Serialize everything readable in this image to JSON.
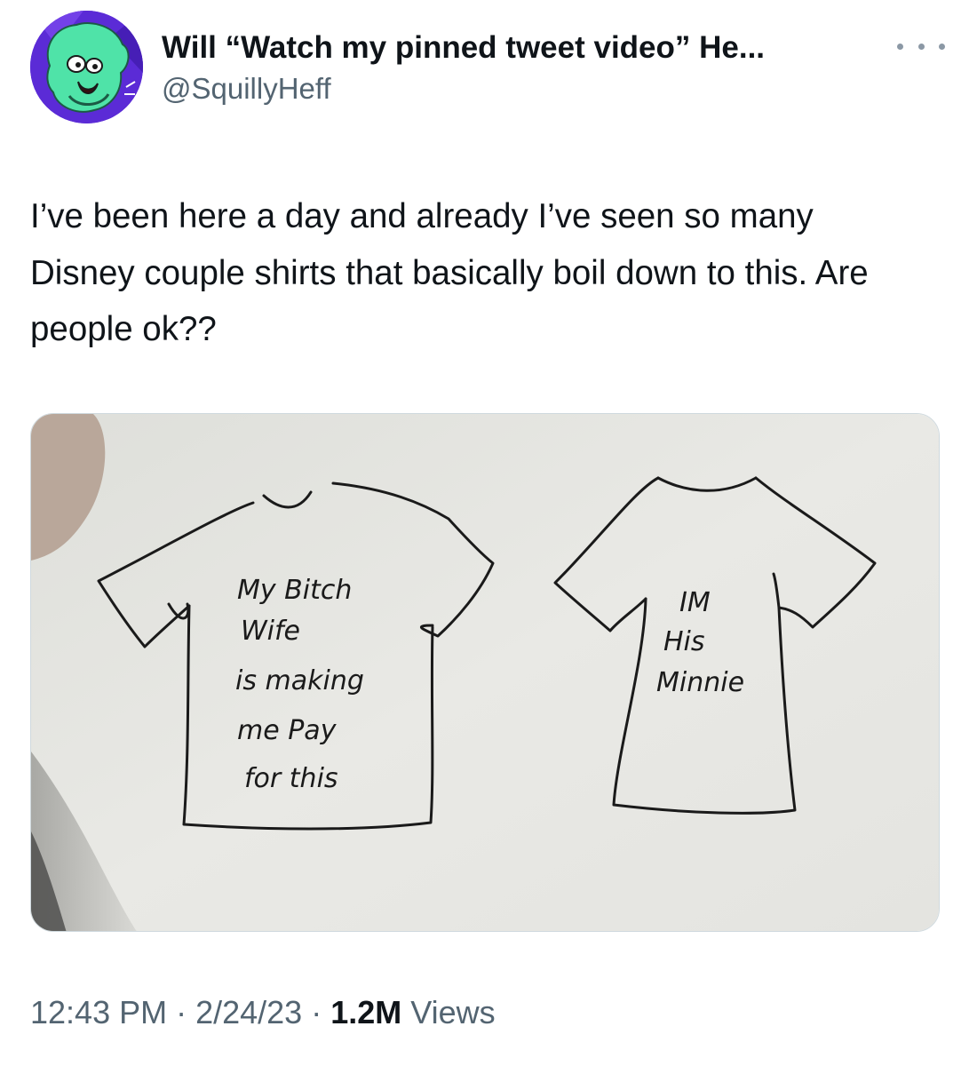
{
  "author": {
    "display_name": "Will “Watch my pinned tweet video” He...",
    "handle": "@SquillyHeff",
    "avatar_icon": "cartoon-avatar-icon"
  },
  "more_icon": "more-options-icon",
  "tweet": {
    "text": "I’ve been here a day and already I’ve seen so many Disney couple shirts that basically boil down to this. Are people ok??"
  },
  "media": {
    "left_shirt_lines": [
      "My Bitch",
      "Wife",
      "is making",
      "me Pay",
      "for this"
    ],
    "right_shirt_lines": [
      "IM",
      "His",
      "Minnie"
    ]
  },
  "meta": {
    "time": "12:43 PM",
    "separator": " · ",
    "date": "2/24/23",
    "views_count": "1.2M",
    "views_label": "Views"
  },
  "colors": {
    "text_primary": "#0f1419",
    "text_secondary": "#536471",
    "avatar_bg": "#5b2bd6",
    "avatar_face": "#4fe3a8"
  }
}
